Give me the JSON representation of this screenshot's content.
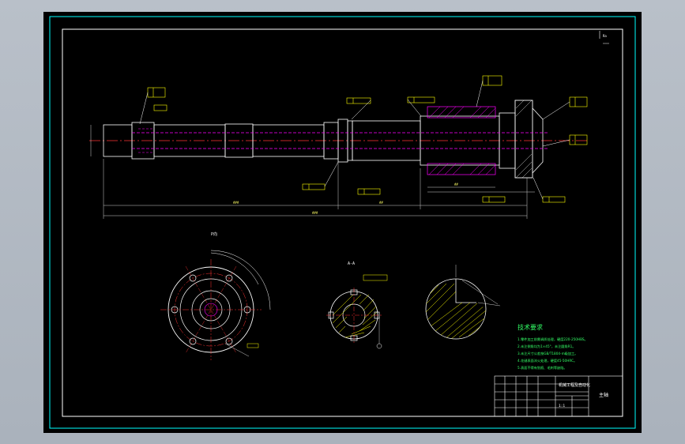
{
  "colors": {
    "background": "#000000",
    "frame": "#00ffff",
    "outline": "#ffffff",
    "hidden": "#ff00ff",
    "center": "#ff3333",
    "dimension": "#ffff00",
    "notes": "#33ff66",
    "section_hatch": "#ffff00"
  },
  "views": {
    "detail_label": "P向",
    "section_label": "A-A"
  },
  "notes": {
    "title": "技术要求",
    "items": [
      "1.零件加工前需调质处理，硬度220-250HBS。",
      "2.未注倒角均为1×45°，未注圆角R1。",
      "3.未注尺寸公差按GB/T1804-m级加工。",
      "4.花键表面淬火处理，硬度45-50HRC。",
      "5.表面不得有划痕、毛刺等缺陷。"
    ]
  },
  "title_block": {
    "part_name": "主轴",
    "heading": "机械工程及自动化",
    "scale": "1:1"
  }
}
